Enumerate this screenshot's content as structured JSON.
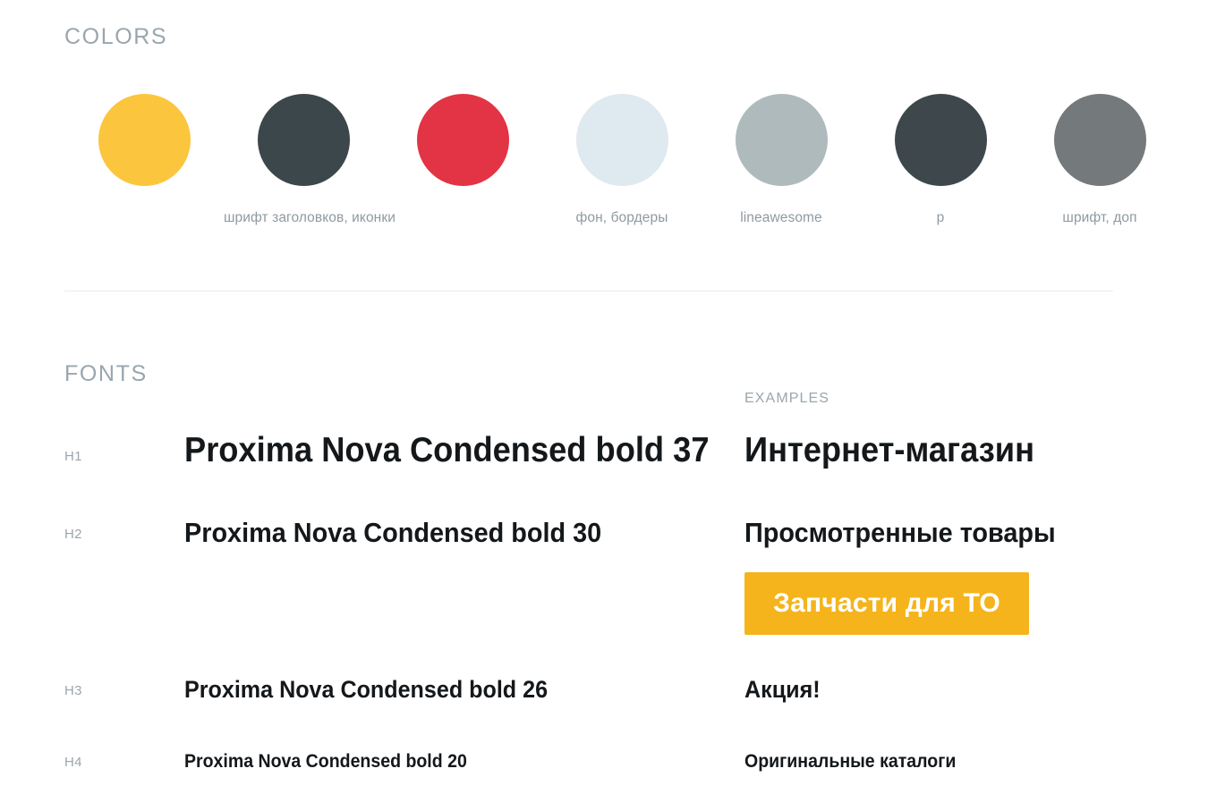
{
  "sections": {
    "colors_title": "COLORS",
    "fonts_title": "FONTS",
    "examples_title": "EXAMPLES"
  },
  "colors": {
    "swatches": [
      {
        "hex": "#fbc63e",
        "caption": ""
      },
      {
        "hex": "#3c474b",
        "caption": "шрифт заголовков, иконки"
      },
      {
        "hex": "#e23444",
        "caption": ""
      },
      {
        "hex": "#dfe9f0",
        "caption": "фон, бордеры"
      },
      {
        "hex": "#afbabd",
        "caption": "lineawesome"
      },
      {
        "hex": "#3e484c",
        "caption": "p"
      },
      {
        "hex": "#74797c",
        "caption": "шрифт, доп"
      }
    ]
  },
  "fonts": {
    "rows": [
      {
        "level": "H1",
        "spec": "Proxima Nova Condensed bold 37",
        "example": "Интернет-магазин"
      },
      {
        "level": "H2",
        "spec": "Proxima Nova Condensed bold 30",
        "example": "Просмотренные товары"
      },
      {
        "level": "H3",
        "spec": "Proxima Nova Condensed bold 26",
        "example": "Акция!"
      },
      {
        "level": "H4",
        "spec": "Proxima Nova Condensed bold 20",
        "example": "Оригинальные каталоги"
      }
    ]
  },
  "cta": {
    "label": "Запчасти для ТО",
    "background": "#f5b41c",
    "text_color": "#ffffff"
  },
  "divider_color": "#e4edf2"
}
